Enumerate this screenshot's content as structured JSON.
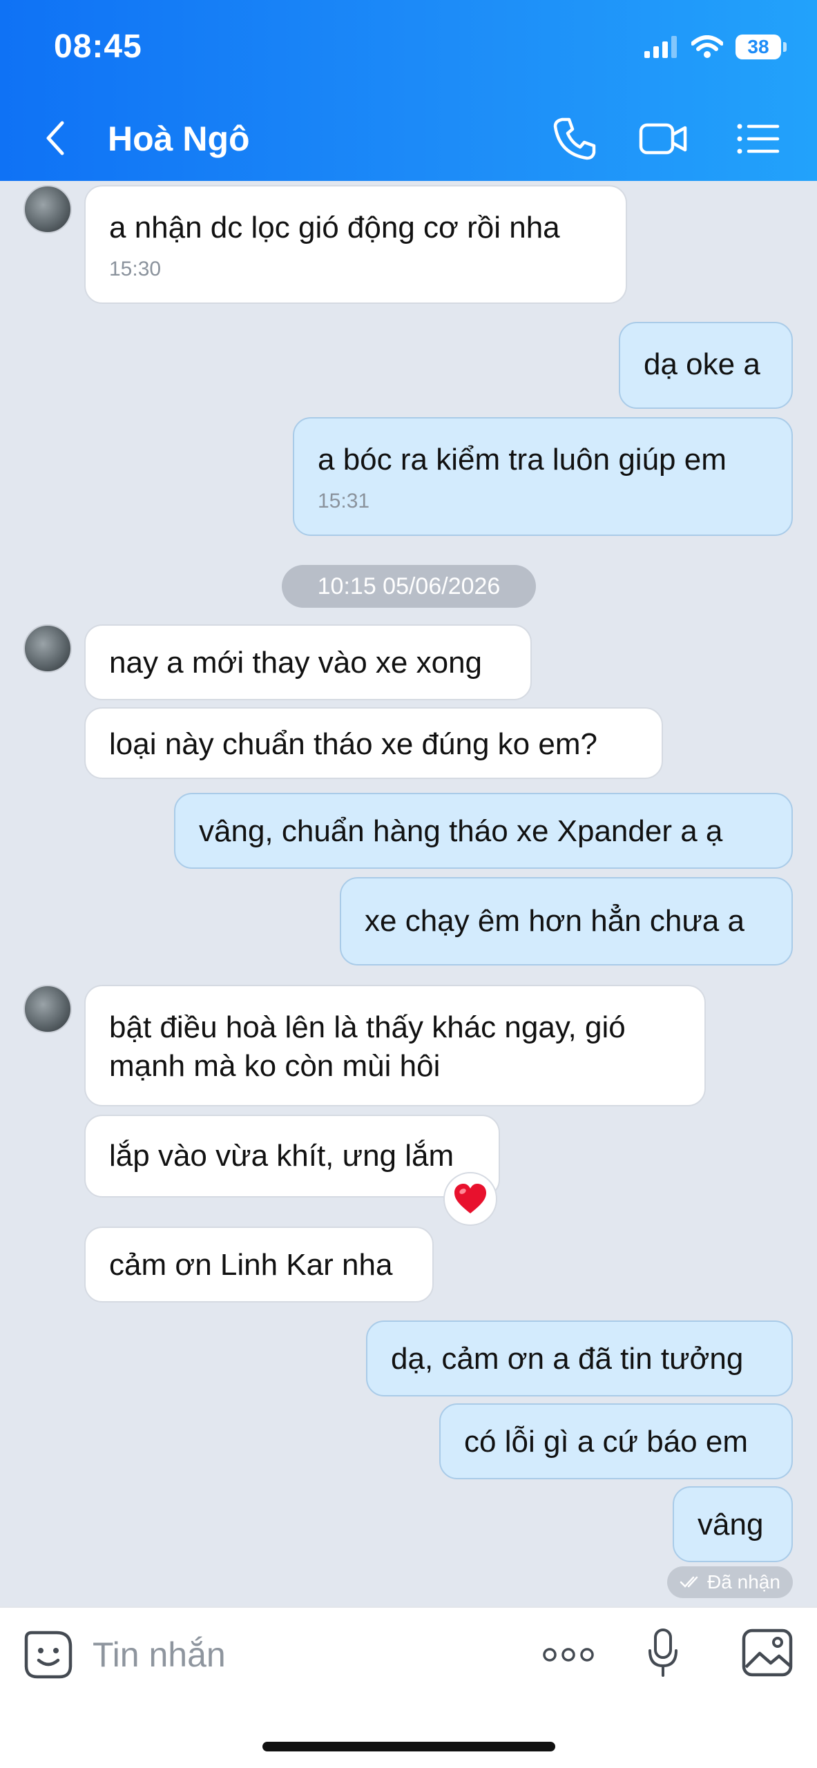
{
  "status_bar": {
    "time": "08:45",
    "battery": "38",
    "icons": [
      "signal-icon",
      "wifi-icon",
      "battery-icon"
    ]
  },
  "header": {
    "contact_name": "Hoà Ngô",
    "icons": [
      "back-icon",
      "phone-icon",
      "video-icon",
      "list-icon"
    ]
  },
  "messages": [
    {
      "dir": "in",
      "text": "a nhận dc lọc gió động cơ rồi nha",
      "time": "15:30"
    },
    {
      "dir": "out",
      "text": "dạ oke a"
    },
    {
      "dir": "out",
      "text": "a bóc ra kiểm tra luôn giúp em",
      "time": "15:31"
    },
    {
      "dir": "in",
      "text": "nay a mới thay vào xe xong"
    },
    {
      "dir": "in",
      "text": "loại này chuẩn tháo xe đúng ko em?"
    },
    {
      "dir": "out",
      "text": "vâng, chuẩn hàng tháo xe Xpander a ạ"
    },
    {
      "dir": "out",
      "text": "xe chạy êm hơn hẳn chưa a"
    },
    {
      "dir": "in",
      "text_line1": "bật điều hoà lên là thấy khác ngay, gió",
      "text_line2": "mạnh mà ko còn mùi hôi"
    },
    {
      "dir": "in",
      "text": "lắp vào vừa khít, ưng lắm",
      "reaction": "heart-icon"
    },
    {
      "dir": "in",
      "text": "cảm ơn Linh Kar nha"
    },
    {
      "dir": "out",
      "text": "dạ, cảm ơn a đã tin tưởng"
    },
    {
      "dir": "out",
      "text": "có lỗi gì a cứ báo em"
    },
    {
      "dir": "out",
      "text": "vâng"
    }
  ],
  "date_separator": "10:15 05/06/2026",
  "seen_status": "Đã nhận",
  "composer": {
    "placeholder": "Tin nhắn",
    "icons": [
      "sticker-icon",
      "more-icon",
      "mic-icon",
      "image-icon"
    ]
  },
  "colors": {
    "header_start": "#0f72f5",
    "header_end": "#22a2fb",
    "chat_background": "#e2e7ef",
    "incoming_bubble": "#ffffff",
    "outgoing_bubble": "#d3ebfd",
    "reaction_heart": "#e8112d"
  }
}
